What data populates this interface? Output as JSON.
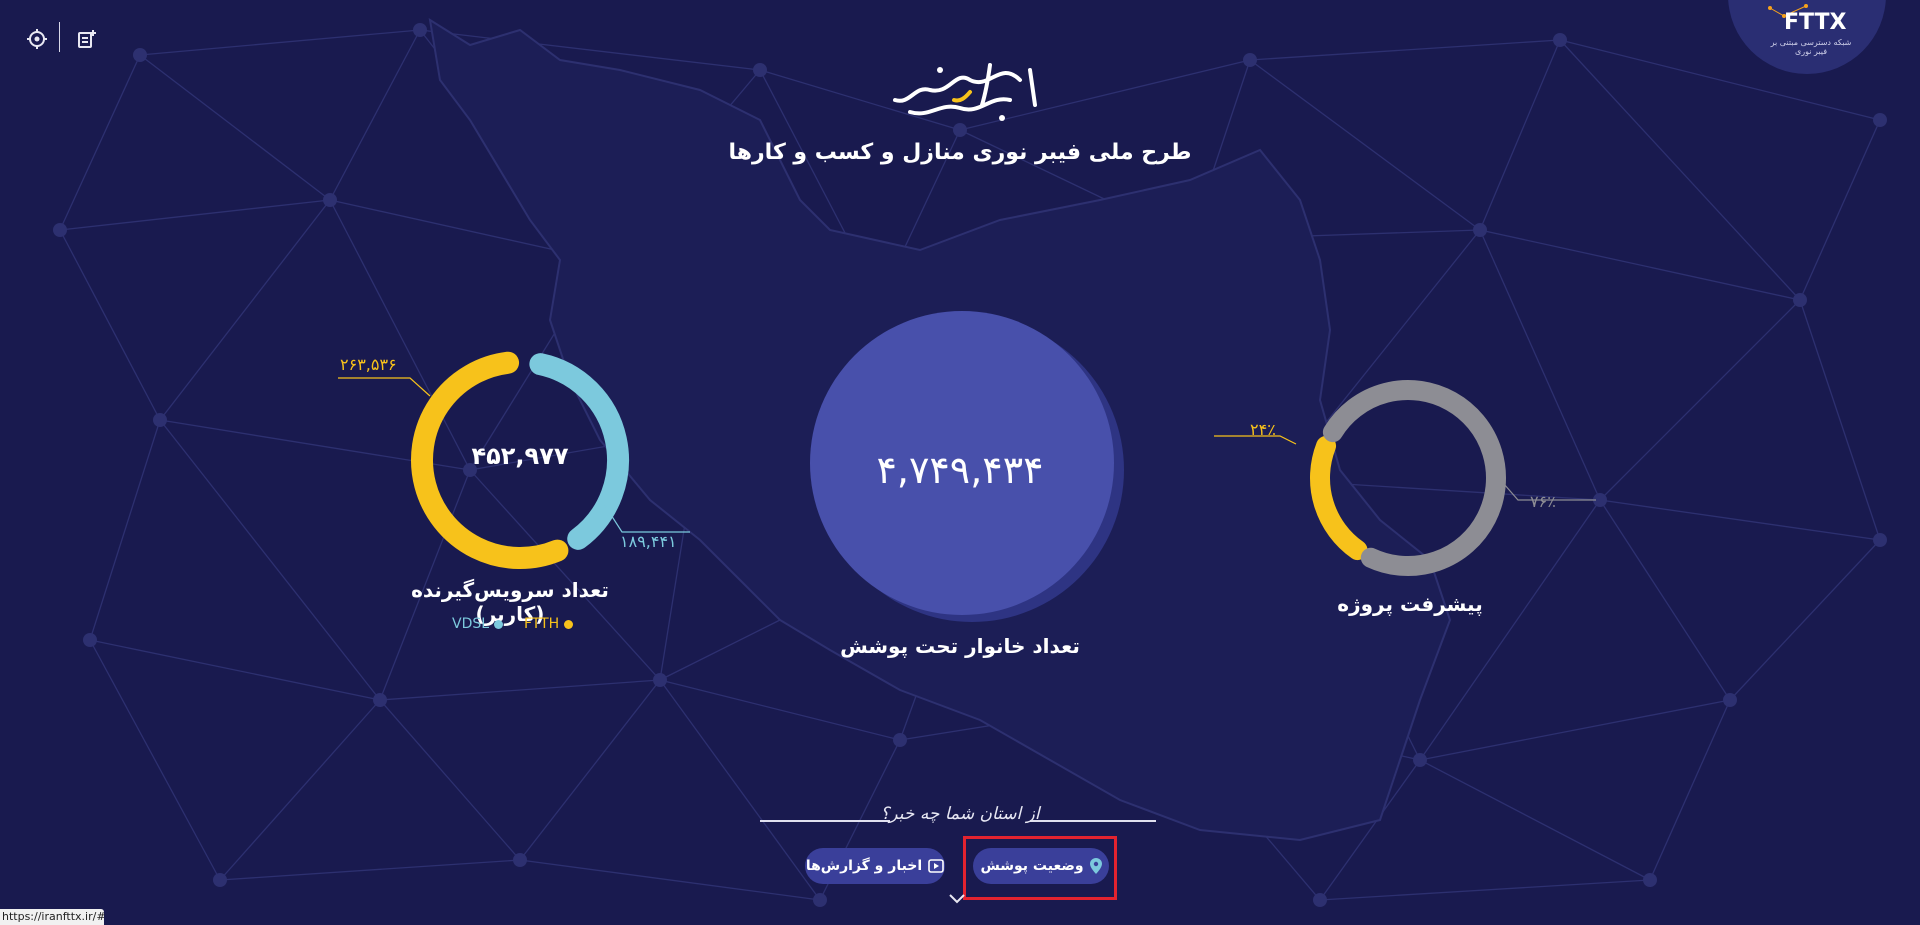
{
  "header": {
    "calligraphy_title": "طعم شیرین فناوری",
    "subtitle": "طرح ملی فیبر نوری منازل و کسب و کارها",
    "logo": {
      "text": "FTTX",
      "tagline": "شبکه دسترسی مبتنی بر فیبر نوری"
    }
  },
  "toolbar": {
    "left_tool_icon": "accessibility-gear-icon",
    "right_tool_icon": "add-note-icon"
  },
  "subscribers": {
    "total": "۴۵۲,۹۷۷",
    "ftth_value": "۲۶۳,۵۳۶",
    "vdsl_value": "۱۸۹,۴۴۱",
    "caption": "تعداد سرویس‌گیرنده (کاربر)",
    "legend": {
      "ftth": "FTTH",
      "vdsl": "VDSL"
    }
  },
  "households": {
    "value": "۴,۷۴۹,۴۳۴",
    "caption": "تعداد خانوار تحت پوشش"
  },
  "progress": {
    "done_label": "۲۴٪",
    "remaining_label": "۷۶٪",
    "caption": "پیشرفت پروژه"
  },
  "footer": {
    "question": "از استان شما چه خبر؟",
    "coverage_button": "وضعیت پوشش",
    "news_button": "اخبار و گزارش‌ها"
  },
  "status_url": "https://iranfttx.ir/#",
  "chart_data": [
    {
      "type": "pie",
      "variant": "donut",
      "categories": [
        "FTTH",
        "VDSL"
      ],
      "values": [
        263536,
        189441
      ],
      "center_value": 452977,
      "title": "تعداد سرویس‌گیرنده (کاربر)"
    },
    {
      "type": "pie",
      "variant": "donut",
      "categories": [
        "done",
        "remaining"
      ],
      "values": [
        24,
        76
      ],
      "title": "پیشرفت پروژه"
    }
  ],
  "colors": {
    "background": "#191a4f",
    "ftth": "#f7c21b",
    "vdsl": "#7cc9dd",
    "circle": "#4850ab",
    "circle_shadow": "#2e3483",
    "progress_done": "#f7c21b",
    "progress_remaining": "#8d8d94",
    "pill": "#3a3f9a",
    "highlight": "#e3232f"
  }
}
